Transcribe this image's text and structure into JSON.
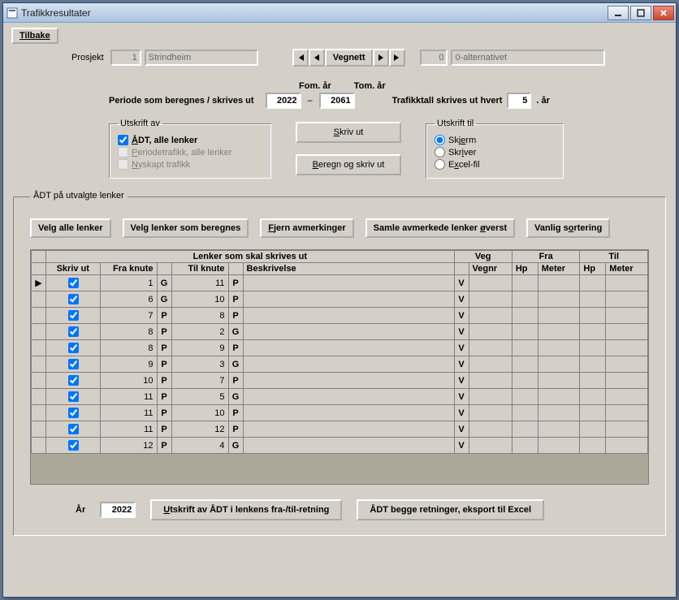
{
  "window": {
    "title": "Trafikkresultater"
  },
  "back_button": "Tilbake",
  "project": {
    "label": "Prosjekt",
    "id": "1",
    "name": "Strindheim"
  },
  "nav": {
    "mid": "Vegnett",
    "alt_id": "0",
    "alt_name": "0-alternativet"
  },
  "period": {
    "label": "Periode som beregnes / skrives ut",
    "from_label": "Fom. år",
    "to_label": "Tom. år",
    "from": "2022",
    "to": "2061",
    "dash": "–",
    "every_label_pre": "Trafikktall skrives ut hvert",
    "every": "5",
    "every_label_post": ". år"
  },
  "print_of": {
    "legend": "Utskrift av",
    "opt1": "ÅDT, alle lenker",
    "opt2": "Periodetrafikk, alle lenker",
    "opt3": "Nyskapt trafikk"
  },
  "mid_buttons": {
    "print": "Skriv ut",
    "calc_print": "Beregn og skriv ut"
  },
  "print_to": {
    "legend": "Utskrift til",
    "opt1": "Skjerm",
    "opt2": "Skriver",
    "opt3": "Excel-fil"
  },
  "selection": {
    "legend": "ÅDT på utvalgte lenker",
    "btn_all": "Velg alle lenker",
    "btn_calc": "Velg lenker som beregnes",
    "btn_clear": "Fjern avmerkinger",
    "btn_top": "Samle avmerkede lenker øverst",
    "btn_sort": "Vanlig sortering"
  },
  "grid": {
    "group_left": "Lenker som skal skrives ut",
    "group_veg": "Veg",
    "group_fra": "Fra",
    "group_til": "Til",
    "col_skriv": "Skriv ut",
    "col_fra": "Fra knute",
    "col_fra2": "",
    "col_til": "Til knute",
    "col_til2": "",
    "col_besk": "Beskrivelse",
    "col_veg1": "",
    "col_vegnr": "Vegnr",
    "col_hp": "Hp",
    "col_meter": "Meter",
    "rows": [
      {
        "sel": true,
        "fra": 1,
        "fk": "G",
        "til": 11,
        "tk": "P",
        "desc": "",
        "veg": "V"
      },
      {
        "sel": true,
        "fra": 6,
        "fk": "G",
        "til": 10,
        "tk": "P",
        "desc": "",
        "veg": "V"
      },
      {
        "sel": true,
        "fra": 7,
        "fk": "P",
        "til": 8,
        "tk": "P",
        "desc": "",
        "veg": "V"
      },
      {
        "sel": true,
        "fra": 8,
        "fk": "P",
        "til": 2,
        "tk": "G",
        "desc": "",
        "veg": "V"
      },
      {
        "sel": true,
        "fra": 8,
        "fk": "P",
        "til": 9,
        "tk": "P",
        "desc": "",
        "veg": "V"
      },
      {
        "sel": true,
        "fra": 9,
        "fk": "P",
        "til": 3,
        "tk": "G",
        "desc": "",
        "veg": "V"
      },
      {
        "sel": true,
        "fra": 10,
        "fk": "P",
        "til": 7,
        "tk": "P",
        "desc": "",
        "veg": "V"
      },
      {
        "sel": true,
        "fra": 11,
        "fk": "P",
        "til": 5,
        "tk": "G",
        "desc": "",
        "veg": "V"
      },
      {
        "sel": true,
        "fra": 11,
        "fk": "P",
        "til": 10,
        "tk": "P",
        "desc": "",
        "veg": "V"
      },
      {
        "sel": true,
        "fra": 11,
        "fk": "P",
        "til": 12,
        "tk": "P",
        "desc": "",
        "veg": "V"
      },
      {
        "sel": true,
        "fra": 12,
        "fk": "P",
        "til": 4,
        "tk": "G",
        "desc": "",
        "veg": "V"
      }
    ]
  },
  "bottom": {
    "year_label": "År",
    "year": "2022",
    "btn_fra_til": "Utskrift av ÅDT i lenkens fra-/til-retning",
    "btn_both": "ÅDT begge retninger, eksport til Excel"
  }
}
